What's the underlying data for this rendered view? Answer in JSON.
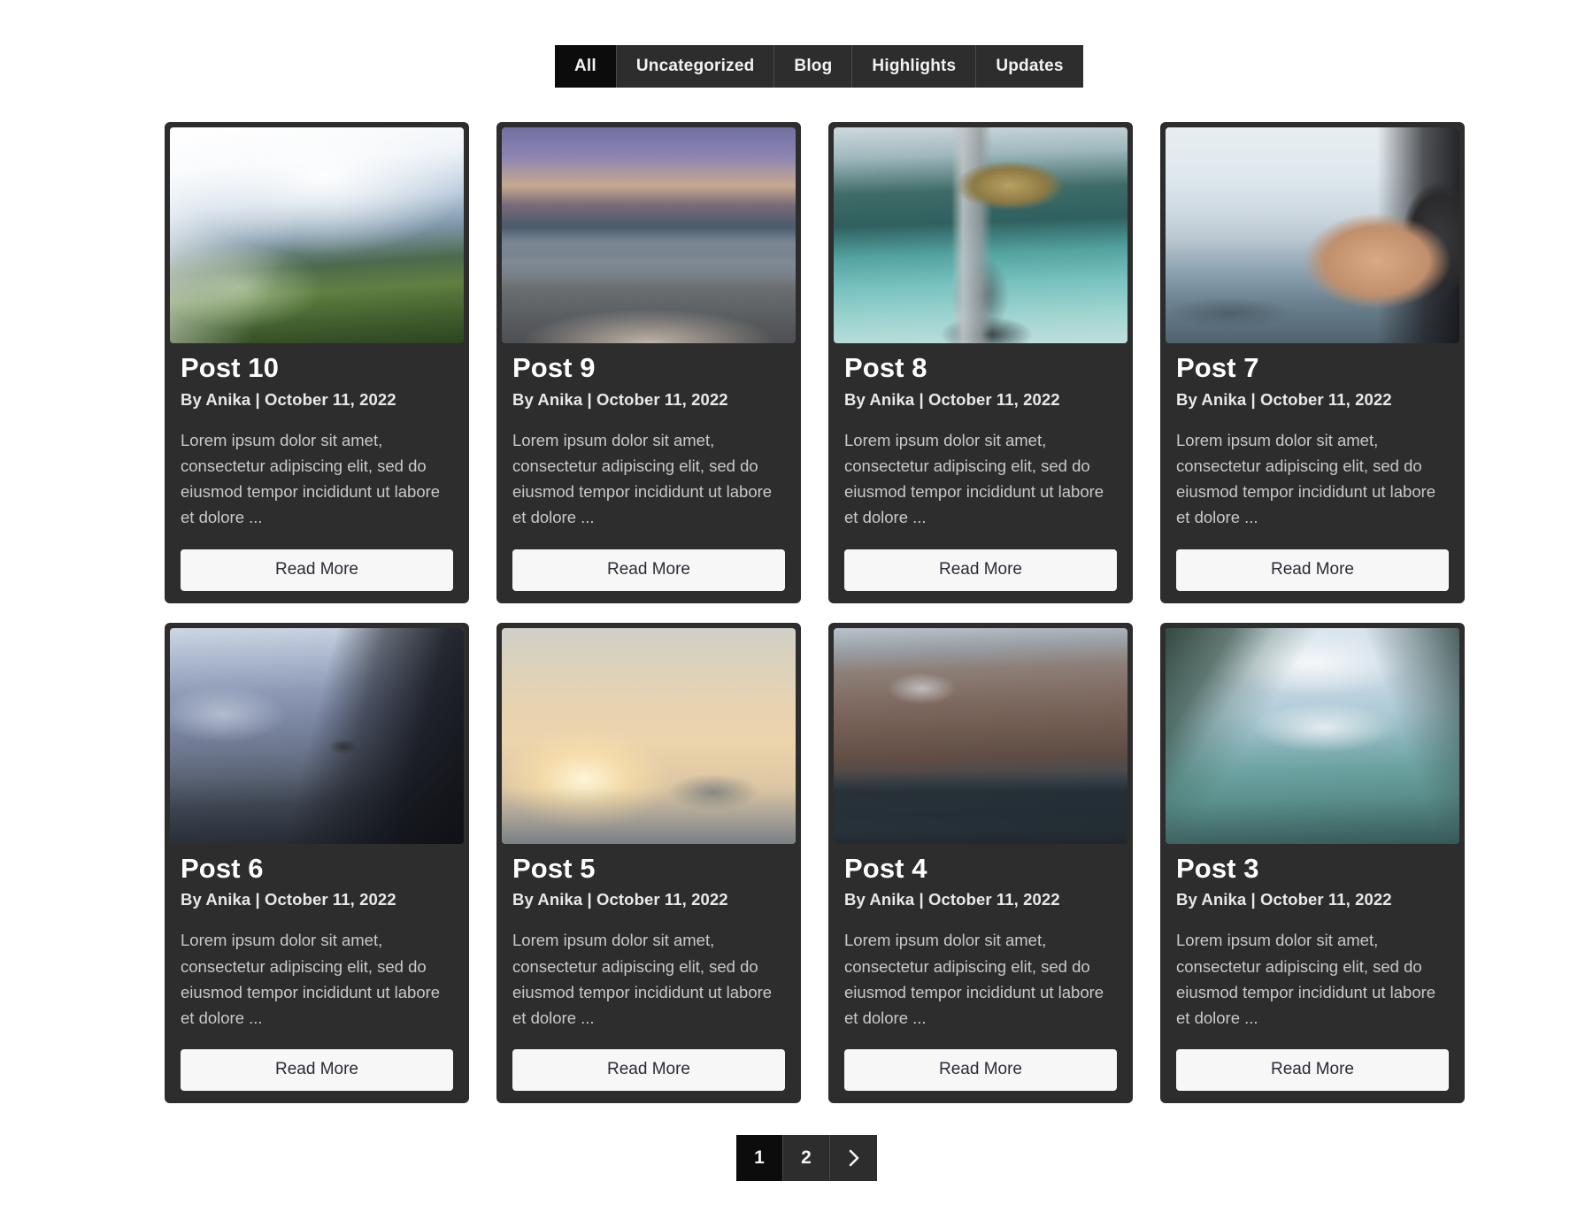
{
  "filters": {
    "tabs": [
      {
        "label": "All",
        "active": true
      },
      {
        "label": "Uncategorized",
        "active": false
      },
      {
        "label": "Blog",
        "active": false
      },
      {
        "label": "Highlights",
        "active": false
      },
      {
        "label": "Updates",
        "active": false
      }
    ]
  },
  "posts": [
    {
      "title": "Post 10",
      "meta": "By Anika | October 11, 2022",
      "excerpt": "Lorem ipsum dolor sit amet, consectetur adipiscing elit, sed do eiusmod tempor incididunt ut labore et dolore ...",
      "button": "Read More",
      "image": "mountain-valley-photo"
    },
    {
      "title": "Post 9",
      "meta": "By Anika | October 11, 2022",
      "excerpt": "Lorem ipsum dolor sit amet, consectetur adipiscing elit, sed do eiusmod tempor incididunt ut labore et dolore ...",
      "button": "Read More",
      "image": "lake-dock-photo"
    },
    {
      "title": "Post 8",
      "meta": "By Anika | October 11, 2022",
      "excerpt": "Lorem ipsum dolor sit amet, consectetur adipiscing elit, sed do eiusmod tempor incididunt ut labore et dolore ...",
      "button": "Read More",
      "image": "tower-binoculars-photo"
    },
    {
      "title": "Post 7",
      "meta": "By Anika | October 11, 2022",
      "excerpt": "Lorem ipsum dolor sit amet, consectetur adipiscing elit, sed do eiusmod tempor incididunt ut labore et dolore ...",
      "button": "Read More",
      "image": "hand-camera-photo"
    },
    {
      "title": "Post 6",
      "meta": "By Anika | October 11, 2022",
      "excerpt": "Lorem ipsum dolor sit amet, consectetur adipiscing elit, sed do eiusmod tempor incididunt ut labore et dolore ...",
      "button": "Read More",
      "image": "cliff-fjord-photo"
    },
    {
      "title": "Post 5",
      "meta": "By Anika | October 11, 2022",
      "excerpt": "Lorem ipsum dolor sit amet, consectetur adipiscing elit, sed do eiusmod tempor incididunt ut labore et dolore ...",
      "button": "Read More",
      "image": "sunrise-coast-photo"
    },
    {
      "title": "Post 4",
      "meta": "By Anika | October 11, 2022",
      "excerpt": "Lorem ipsum dolor sit amet, consectetur adipiscing elit, sed do eiusmod tempor incididunt ut labore et dolore ...",
      "button": "Read More",
      "image": "red-mountain-dock-photo"
    },
    {
      "title": "Post 3",
      "meta": "By Anika | October 11, 2022",
      "excerpt": "Lorem ipsum dolor sit amet, consectetur adipiscing elit, sed do eiusmod tempor incididunt ut labore et dolore ...",
      "button": "Read More",
      "image": "lake-louise-photo"
    }
  ],
  "pagination": {
    "pages": [
      {
        "label": "1",
        "active": true
      },
      {
        "label": "2",
        "active": false
      }
    ],
    "next_label": "›",
    "next_icon": "chevron-right-icon"
  },
  "colors": {
    "card_background": "#2d2d2d",
    "active_tab_background": "#0c0c0c",
    "page_background": "#ffffff",
    "button_background": "#f7f7f7",
    "button_text": "#2b2b38",
    "title_text": "#ffffff",
    "excerpt_text": "#c9c9c9"
  }
}
